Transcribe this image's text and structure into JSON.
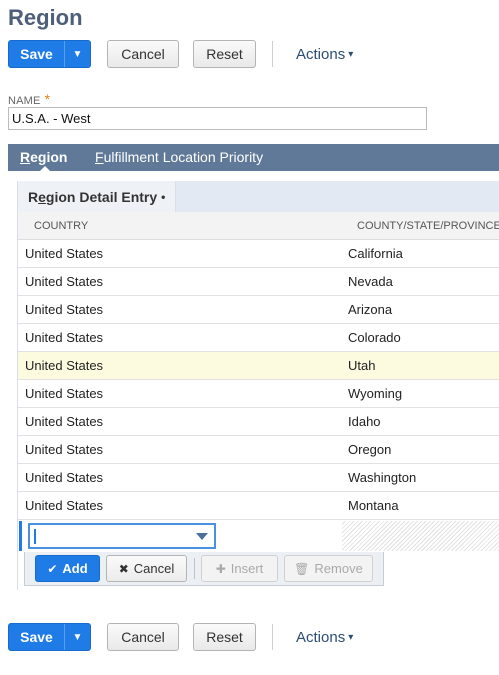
{
  "page": {
    "title": "Region"
  },
  "toolbar": {
    "save_label": "Save",
    "save_caret": "▼",
    "cancel_label": "Cancel",
    "reset_label": "Reset",
    "actions_label": "Actions",
    "actions_caret": "▾"
  },
  "form": {
    "name_label": "NAME",
    "required_mark": "*",
    "name_value": "U.S.A. - West"
  },
  "tabs": [
    {
      "label": "Region",
      "active": true,
      "mnemonic_first": "R",
      "rest": "egion"
    },
    {
      "label": "Fulfillment Location Priority",
      "active": false,
      "mnemonic_first": "F",
      "rest": "ulfillment Location Priority"
    }
  ],
  "subtab": {
    "label": "Region Detail Entry",
    "label_pre": "R",
    "label_mnemonic": "e",
    "label_post": "gion Detail Entry",
    "dot": "•"
  },
  "grid": {
    "columns": [
      "COUNTRY",
      "COUNTY/STATE/PROVINCE"
    ],
    "rows": [
      {
        "country": "United States",
        "state": "California"
      },
      {
        "country": "United States",
        "state": "Nevada"
      },
      {
        "country": "United States",
        "state": "Arizona"
      },
      {
        "country": "United States",
        "state": "Colorado"
      },
      {
        "country": "United States",
        "state": "Utah",
        "highlighted": true
      },
      {
        "country": "United States",
        "state": "Wyoming"
      },
      {
        "country": "United States",
        "state": "Idaho"
      },
      {
        "country": "United States",
        "state": "Oregon"
      },
      {
        "country": "United States",
        "state": "Washington"
      },
      {
        "country": "United States",
        "state": "Montana"
      }
    ]
  },
  "edit_bar": {
    "add_label": "Add",
    "cancel_label": "Cancel",
    "insert_label": "Insert",
    "remove_label": "Remove"
  },
  "colors": {
    "primary": "#1f7be6",
    "tab_bar": "#607998",
    "title": "#4d5f79",
    "highlight_row": "#fcfbe0"
  }
}
